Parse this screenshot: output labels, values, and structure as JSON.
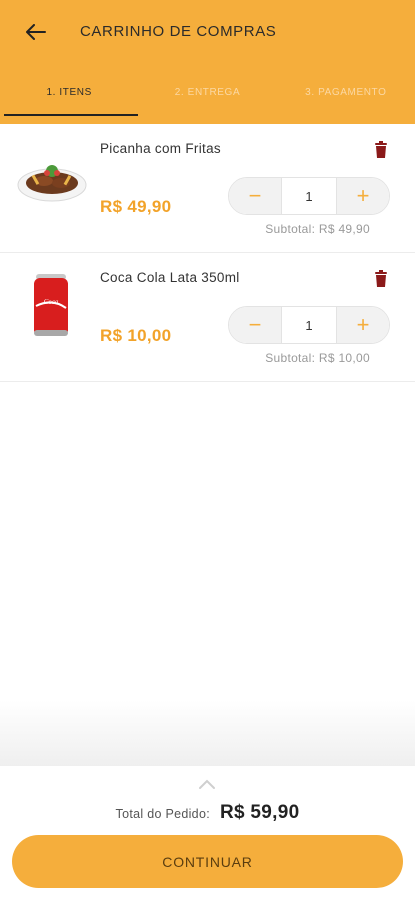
{
  "header": {
    "title": "CARRINHO DE COMPRAS",
    "back_icon": "arrow-left-icon",
    "background": "#f5ae3c"
  },
  "tabs": [
    {
      "label": "1. ITENS",
      "active": true
    },
    {
      "label": "2. ENTREGA",
      "active": false
    },
    {
      "label": "3. PAGAMENTO",
      "active": false
    }
  ],
  "items": [
    {
      "name": "Picanha com Fritas",
      "price": "R$ 49,90",
      "quantity": "1",
      "subtotal": "Subtotal: R$ 49,90",
      "image": "picanha-plate-image"
    },
    {
      "name": "Coca Cola Lata 350ml",
      "price": "R$ 10,00",
      "quantity": "1",
      "subtotal": "Subtotal: R$ 10,00",
      "image": "coca-cola-can-image"
    }
  ],
  "stepper": {
    "minus": "−",
    "plus": "+"
  },
  "footer": {
    "total_label": "Total do Pedido:",
    "total_value": "R$ 59,90",
    "continue_label": "CONTINUAR"
  },
  "colors": {
    "accent": "#f5ae3c",
    "price": "#f2a32a",
    "trash": "#8b1a1a"
  }
}
